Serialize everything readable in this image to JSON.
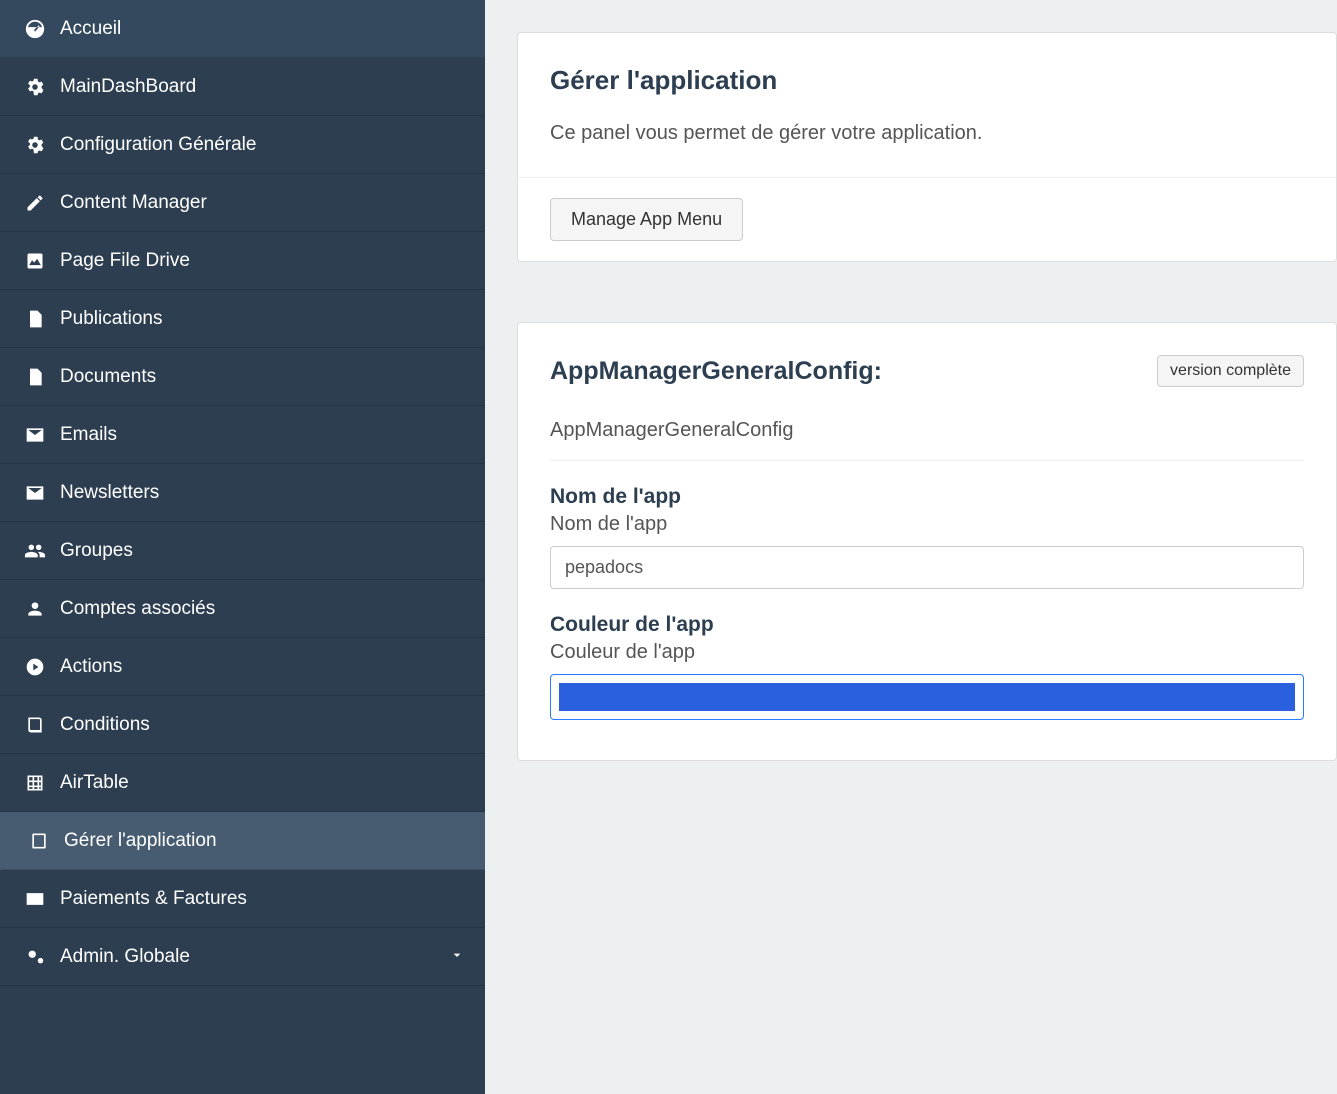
{
  "sidebar": {
    "items": [
      {
        "label": "Accueil",
        "icon": "dashboard"
      },
      {
        "label": "MainDashBoard",
        "icon": "gear"
      },
      {
        "label": "Configuration Générale",
        "icon": "gear"
      },
      {
        "label": "Content Manager",
        "icon": "pencil"
      },
      {
        "label": "Page File Drive",
        "icon": "image"
      },
      {
        "label": "Publications",
        "icon": "doc-lines"
      },
      {
        "label": "Documents",
        "icon": "doc"
      },
      {
        "label": "Emails",
        "icon": "envelope"
      },
      {
        "label": "Newsletters",
        "icon": "envelope"
      },
      {
        "label": "Groupes",
        "icon": "users"
      },
      {
        "label": "Comptes associés",
        "icon": "user"
      },
      {
        "label": "Actions",
        "icon": "play"
      },
      {
        "label": "Conditions",
        "icon": "book"
      },
      {
        "label": "AirTable",
        "icon": "table"
      },
      {
        "label": "Gérer l'application",
        "icon": "tablet",
        "active": true
      },
      {
        "label": "Paiements & Factures",
        "icon": "card"
      },
      {
        "label": "Admin. Globale",
        "icon": "gears",
        "expandable": true
      }
    ]
  },
  "main": {
    "panel1": {
      "title": "Gérer l'application",
      "lead": "Ce panel vous permet de gérer votre application.",
      "action_label": "Manage App Menu"
    },
    "panel2": {
      "title": "AppManagerGeneralConfig:",
      "full_version_label": "version complète",
      "subtitle": "AppManagerGeneralConfig",
      "fields": {
        "name": {
          "title": "Nom de l'app",
          "desc": "Nom de l'app",
          "value": "pepadocs"
        },
        "color": {
          "title": "Couleur de l'app",
          "desc": "Couleur de l'app",
          "value": "#2a5fdd"
        }
      }
    }
  }
}
